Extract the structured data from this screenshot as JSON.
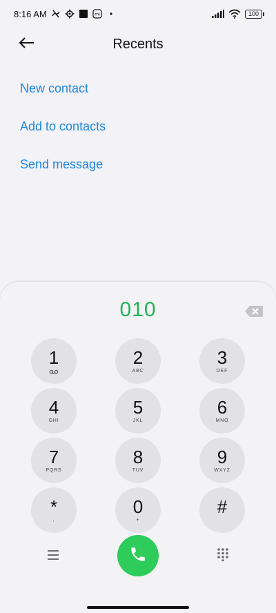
{
  "status_bar": {
    "time": "8:16 AM",
    "battery": "100",
    "icons": [
      "missed-call-icon",
      "settings-cog-icon",
      "square-icon",
      "mi-icon",
      "dot-icon",
      "signal-icon",
      "wifi-icon",
      "battery-icon"
    ]
  },
  "header": {
    "title": "Recents",
    "back_icon": "arrow-left-icon"
  },
  "actions": [
    {
      "label": "New contact"
    },
    {
      "label": "Add to contacts"
    },
    {
      "label": "Send message"
    }
  ],
  "dialer": {
    "number": "010",
    "keys": [
      {
        "digit": "1",
        "letters": ""
      },
      {
        "digit": "2",
        "letters": "ABC"
      },
      {
        "digit": "3",
        "letters": "DEF"
      },
      {
        "digit": "4",
        "letters": "GHI"
      },
      {
        "digit": "5",
        "letters": "JKL"
      },
      {
        "digit": "6",
        "letters": "MNO"
      },
      {
        "digit": "7",
        "letters": "PQRS"
      },
      {
        "digit": "8",
        "letters": "TUV"
      },
      {
        "digit": "9",
        "letters": "WXYZ"
      },
      {
        "digit": "*",
        "letters": ","
      },
      {
        "digit": "0",
        "letters": "+"
      },
      {
        "digit": "#",
        "letters": ""
      }
    ]
  },
  "colors": {
    "accent_blue": "#1f86e0",
    "number_green": "#22b25a",
    "call_green": "#2ecc5a",
    "key_bg": "#e2e2e6",
    "background": "#f2f2f7"
  }
}
